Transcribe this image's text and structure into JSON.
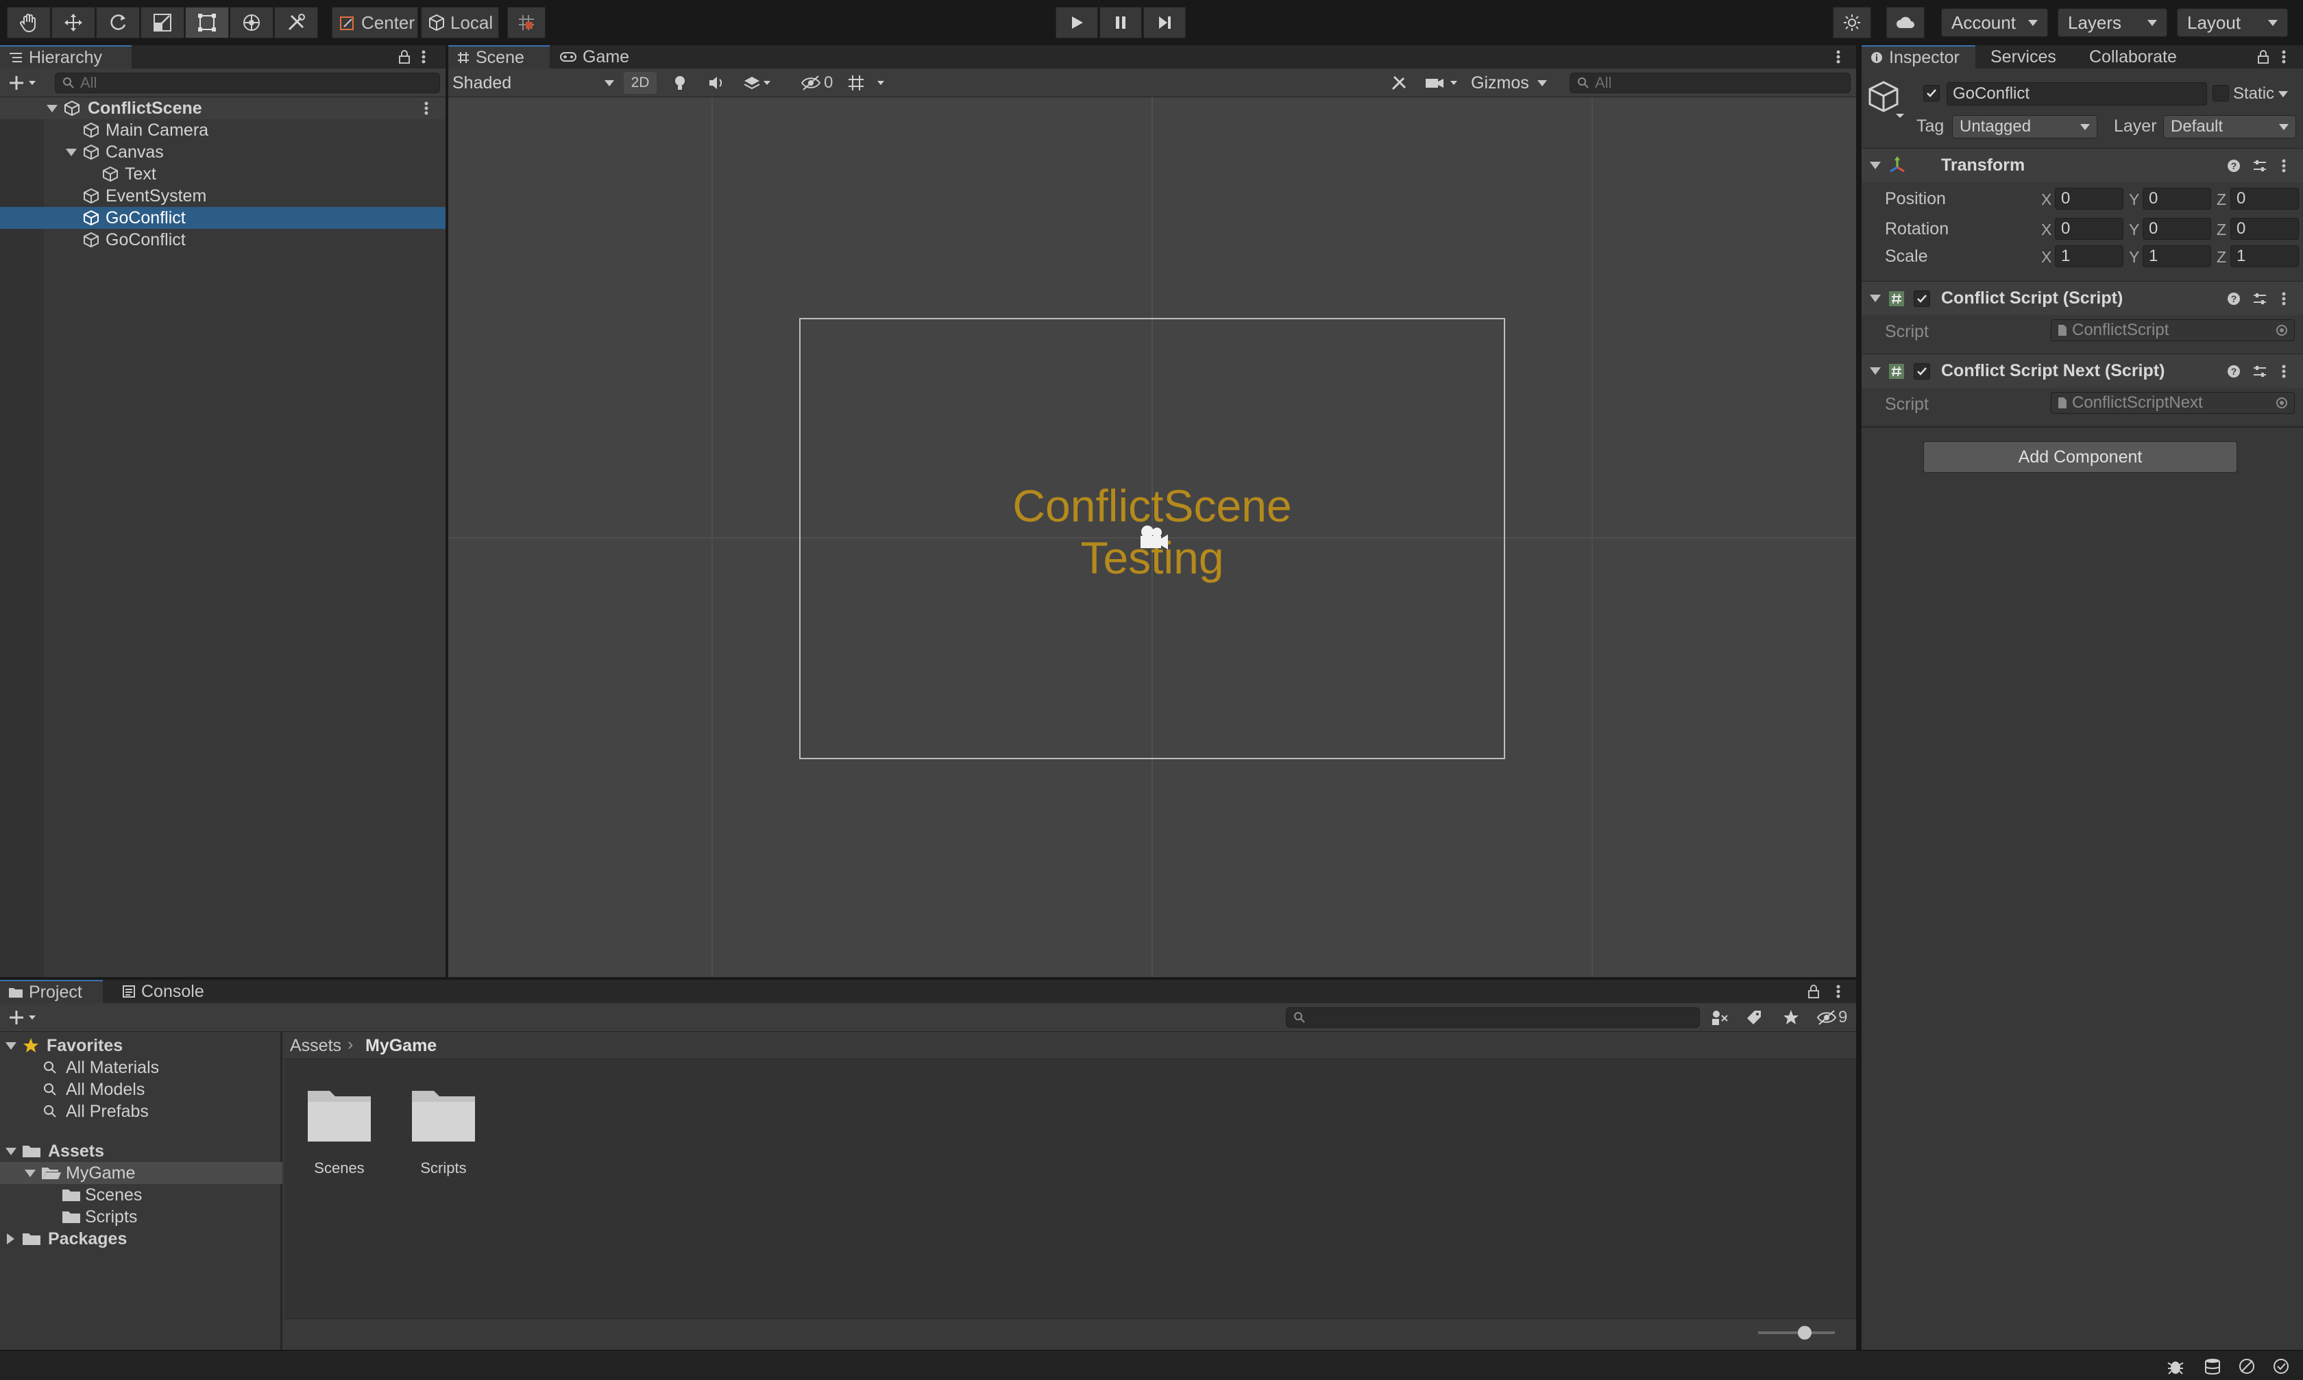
{
  "toolbar": {
    "pivot_label": "Center",
    "space_label": "Local",
    "account_label": "Account",
    "layers_label": "Layers",
    "layout_label": "Layout"
  },
  "hierarchy": {
    "tab_label": "Hierarchy",
    "search_placeholder": "All",
    "items": [
      {
        "label": "ConflictScene"
      },
      {
        "label": "Main Camera"
      },
      {
        "label": "Canvas"
      },
      {
        "label": "Text"
      },
      {
        "label": "EventSystem"
      },
      {
        "label": "GoConflict",
        "selected": true
      },
      {
        "label": "GoConflict"
      }
    ]
  },
  "scene": {
    "tabs": [
      "Scene",
      "Game"
    ],
    "shading_mode": "Shaded",
    "mode_2d": "2D",
    "hidden_count": "0",
    "gizmos_label": "Gizmos",
    "search_placeholder": "All",
    "canvas_text_line1": "ConflictScene",
    "canvas_text_line2": "Testing",
    "canvas_text_color": "#b58a1c"
  },
  "inspector": {
    "tabs": [
      "Inspector",
      "Services",
      "Collaborate"
    ],
    "object_name": "GoConflict",
    "static_label": "Static",
    "tag_label": "Tag",
    "tag_value": "Untagged",
    "layer_label": "Layer",
    "layer_value": "Default",
    "transform": {
      "title": "Transform",
      "position": {
        "label": "Position",
        "x": "0",
        "y": "0",
        "z": "0"
      },
      "rotation": {
        "label": "Rotation",
        "x": "0",
        "y": "0",
        "z": "0"
      },
      "scale": {
        "label": "Scale",
        "x": "1",
        "y": "1",
        "z": "1"
      }
    },
    "components": [
      {
        "title": "Conflict Script (Script)",
        "field_label": "Script",
        "field_value": "ConflictScript"
      },
      {
        "title": "Conflict Script Next (Script)",
        "field_label": "Script",
        "field_value": "ConflictScriptNext"
      }
    ],
    "add_component_label": "Add Component"
  },
  "project": {
    "tabs": [
      "Project",
      "Console"
    ],
    "hidden_count": "9",
    "tree": [
      {
        "label": "Favorites",
        "bold": true
      },
      {
        "label": "All Materials"
      },
      {
        "label": "All Models"
      },
      {
        "label": "All Prefabs"
      },
      {
        "label": "Assets",
        "bold": true
      },
      {
        "label": "MyGame",
        "selected": true
      },
      {
        "label": "Scenes"
      },
      {
        "label": "Scripts"
      },
      {
        "label": "Packages",
        "bold": true
      }
    ],
    "breadcrumb": [
      "Assets",
      "MyGame"
    ],
    "folders": [
      "Scenes",
      "Scripts"
    ]
  },
  "colors": {
    "selection": "#2c5d87",
    "accent_tab": "#3a72b0",
    "canvas_text": "#b58a1c"
  }
}
